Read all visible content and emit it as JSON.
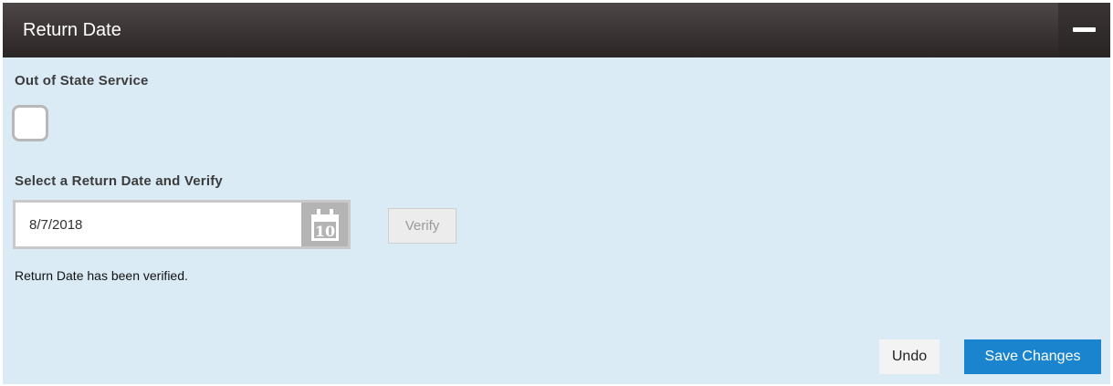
{
  "panel": {
    "title": "Return Date",
    "collapse_icon": "minus-icon"
  },
  "out_of_state": {
    "label": "Out of State Service",
    "checked": false
  },
  "return_date": {
    "label": "Select a Return Date and Verify",
    "value": "8/7/2018",
    "calendar_icon": "calendar-icon",
    "calendar_day": "10",
    "verify_label": "Verify"
  },
  "status": {
    "message": "Return Date has been verified."
  },
  "actions": {
    "undo_label": "Undo",
    "save_label": "Save Changes"
  },
  "colors": {
    "panel_background": "#dbebf5",
    "header_background": "#3e3737",
    "primary_button": "#1a84cf"
  }
}
